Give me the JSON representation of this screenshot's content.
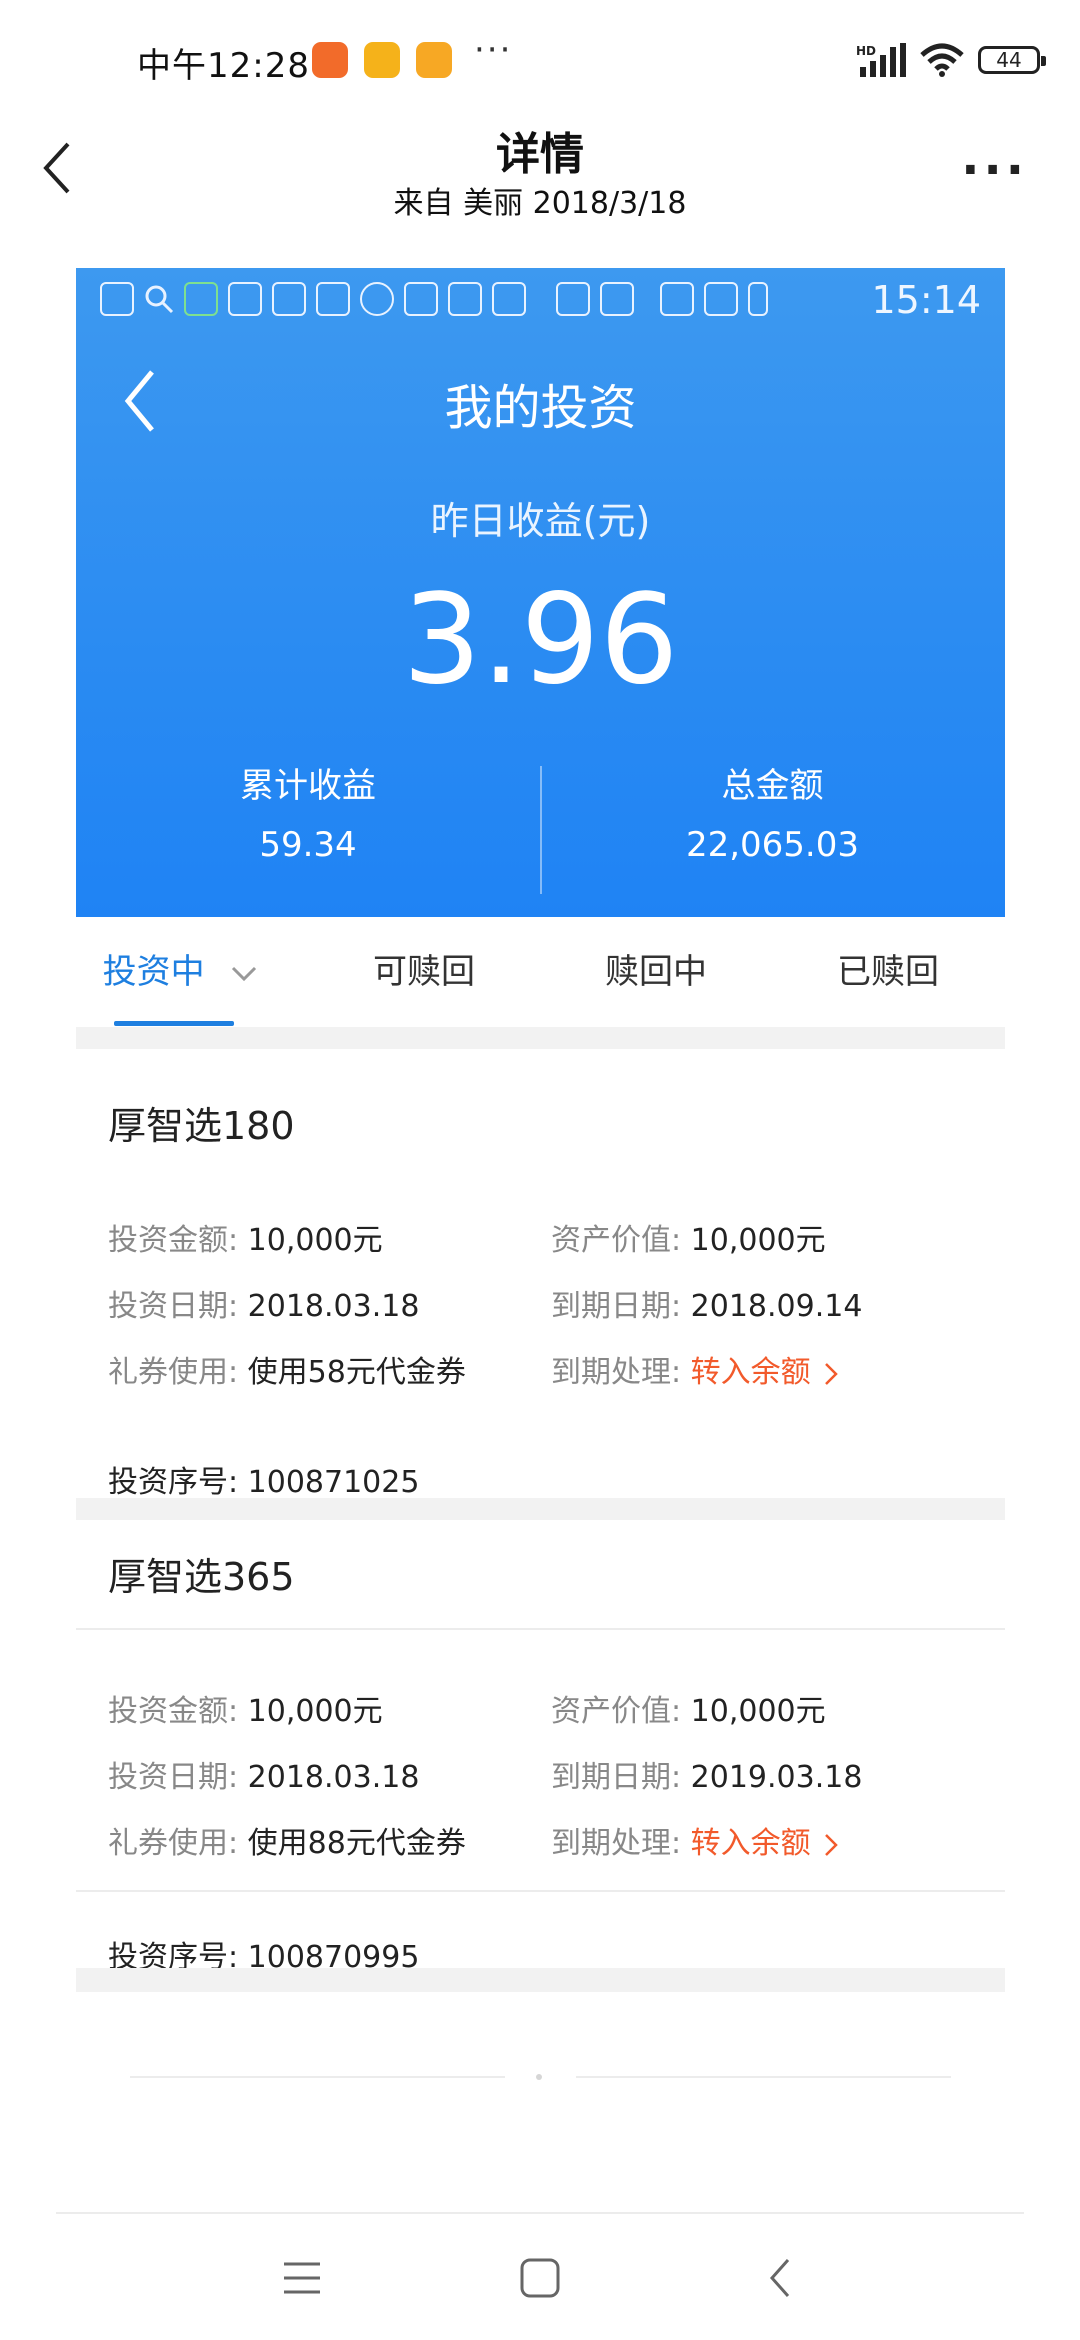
{
  "status_bar": {
    "time": "中午12:28",
    "battery": "44",
    "notification_icons": [
      "colorful-app-icon",
      "mail-icon",
      "note-icon"
    ],
    "overflow": "···"
  },
  "header": {
    "title": "详情",
    "subtitle": "来自 美丽 2018/3/18",
    "more_label": "···"
  },
  "shot": {
    "status_time": "15:14",
    "title": "我的投资",
    "yesterday_label": "昨日收益(元)",
    "yesterday_value": "3.96",
    "cumulative_label": "累计收益",
    "cumulative_value": "59.34",
    "total_label": "总金额",
    "total_value": "22,065.03",
    "tabs": [
      "投资中",
      "可赎回",
      "赎回中",
      "已赎回"
    ],
    "products": [
      {
        "name": "厚智选180",
        "amount_label": "投资金额:",
        "amount": "10,000元",
        "value_label": "资产价值:",
        "value": "10,000元",
        "date_label": "投资日期:",
        "date": "2018.03.18",
        "due_label": "到期日期:",
        "due": "2018.09.14",
        "coupon_label": "礼券使用:",
        "coupon": "使用58元代金券",
        "handle_label": "到期处理:",
        "handle": "转入余额",
        "serial_label": "投资序号:",
        "serial": "100871025"
      },
      {
        "name": "厚智选365",
        "amount_label": "投资金额:",
        "amount": "10,000元",
        "value_label": "资产价值:",
        "value": "10,000元",
        "date_label": "投资日期:",
        "date": "2018.03.18",
        "due_label": "到期日期:",
        "due": "2019.03.18",
        "coupon_label": "礼券使用:",
        "coupon": "使用88元代金券",
        "handle_label": "到期处理:",
        "handle": "转入余额",
        "serial_label": "投资序号:",
        "serial": "100870995"
      }
    ]
  },
  "colors": {
    "brand_blue": "#2a8bf2",
    "tab_active": "#1e7fe0",
    "accent_orange": "#f25a2b"
  }
}
